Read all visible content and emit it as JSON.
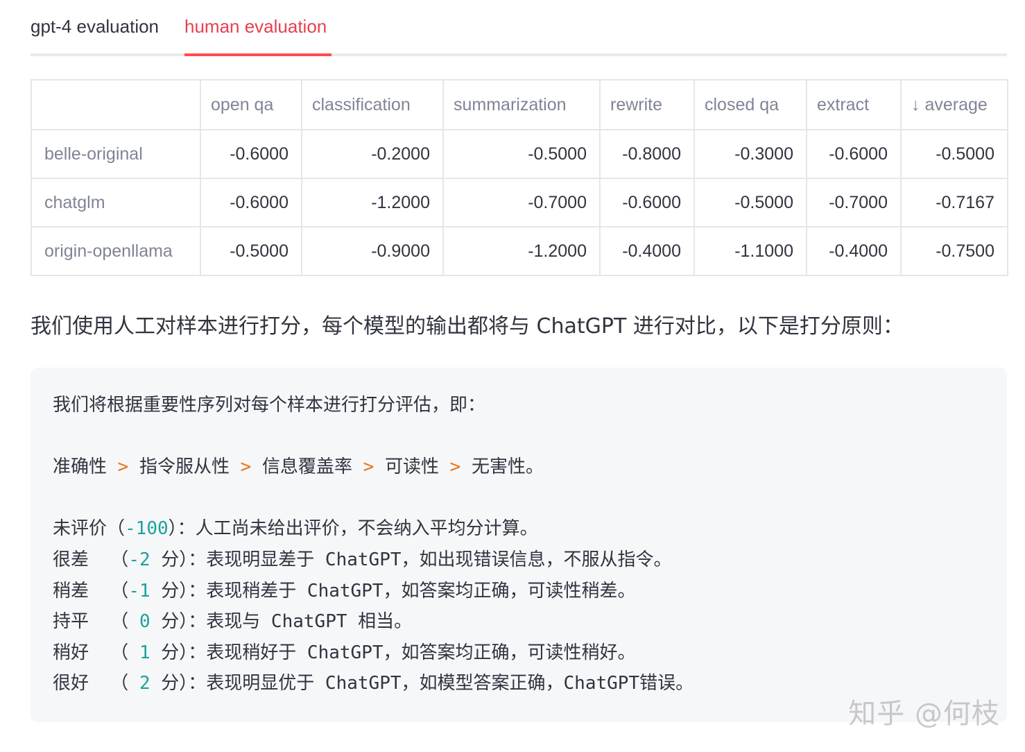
{
  "tabs": [
    {
      "label": "gpt-4 evaluation",
      "active": false
    },
    {
      "label": "human evaluation",
      "active": true
    }
  ],
  "table": {
    "columns": [
      "",
      "open qa",
      "classification",
      "summarization",
      "rewrite",
      "closed qa",
      "extract",
      "↓ average"
    ],
    "rows": [
      {
        "name": "belle-original",
        "values": [
          "-0.6000",
          "-0.2000",
          "-0.5000",
          "-0.8000",
          "-0.3000",
          "-0.6000",
          "-0.5000"
        ]
      },
      {
        "name": "chatglm",
        "values": [
          "-0.6000",
          "-1.2000",
          "-0.7000",
          "-0.6000",
          "-0.5000",
          "-0.7000",
          "-0.7167"
        ]
      },
      {
        "name": "origin-openllama",
        "values": [
          "-0.5000",
          "-0.9000",
          "-1.2000",
          "-0.4000",
          "-1.1000",
          "-0.4000",
          "-0.7500"
        ]
      }
    ]
  },
  "intro": "我们使用人工对样本进行打分，每个模型的输出都将与 ChatGPT 进行对比，以下是打分原则：",
  "code": {
    "line1": "我们将根据重要性序列对每个样本进行打分评估，即：",
    "priority": [
      "准确性",
      "指令服从性",
      "信息覆盖率",
      "可读性",
      "无害性。"
    ],
    "priority_sep": ">",
    "scores": [
      {
        "label": "未评价（",
        "num": "-100",
        "suffix": "）：",
        "desc": "人工尚未给出评价，不会纳入平均分计算。"
      },
      {
        "label": "很差  （",
        "num": "-2",
        "suffix": " 分）：",
        "desc": "表现明显差于 ChatGPT，如出现错误信息，不服从指令。"
      },
      {
        "label": "稍差  （",
        "num": "-1",
        "suffix": " 分）：",
        "desc": "表现稍差于 ChatGPT，如答案均正确，可读性稍差。"
      },
      {
        "label": "持平  （ ",
        "num": "0",
        "suffix": " 分）：",
        "desc": "表现与 ChatGPT 相当。"
      },
      {
        "label": "稍好  （ ",
        "num": "1",
        "suffix": " 分）：",
        "desc": "表现稍好于 ChatGPT，如答案均正确，可读性稍好。"
      },
      {
        "label": "很好  （ ",
        "num": "2",
        "suffix": " 分）：",
        "desc": "表现明显优于 ChatGPT，如模型答案正确，ChatGPT错误。"
      }
    ]
  },
  "watermark": "知乎 @何枝",
  "colors": {
    "accent": "#ff4b4b",
    "operator": "#e8761b",
    "number": "#1aa29a"
  }
}
